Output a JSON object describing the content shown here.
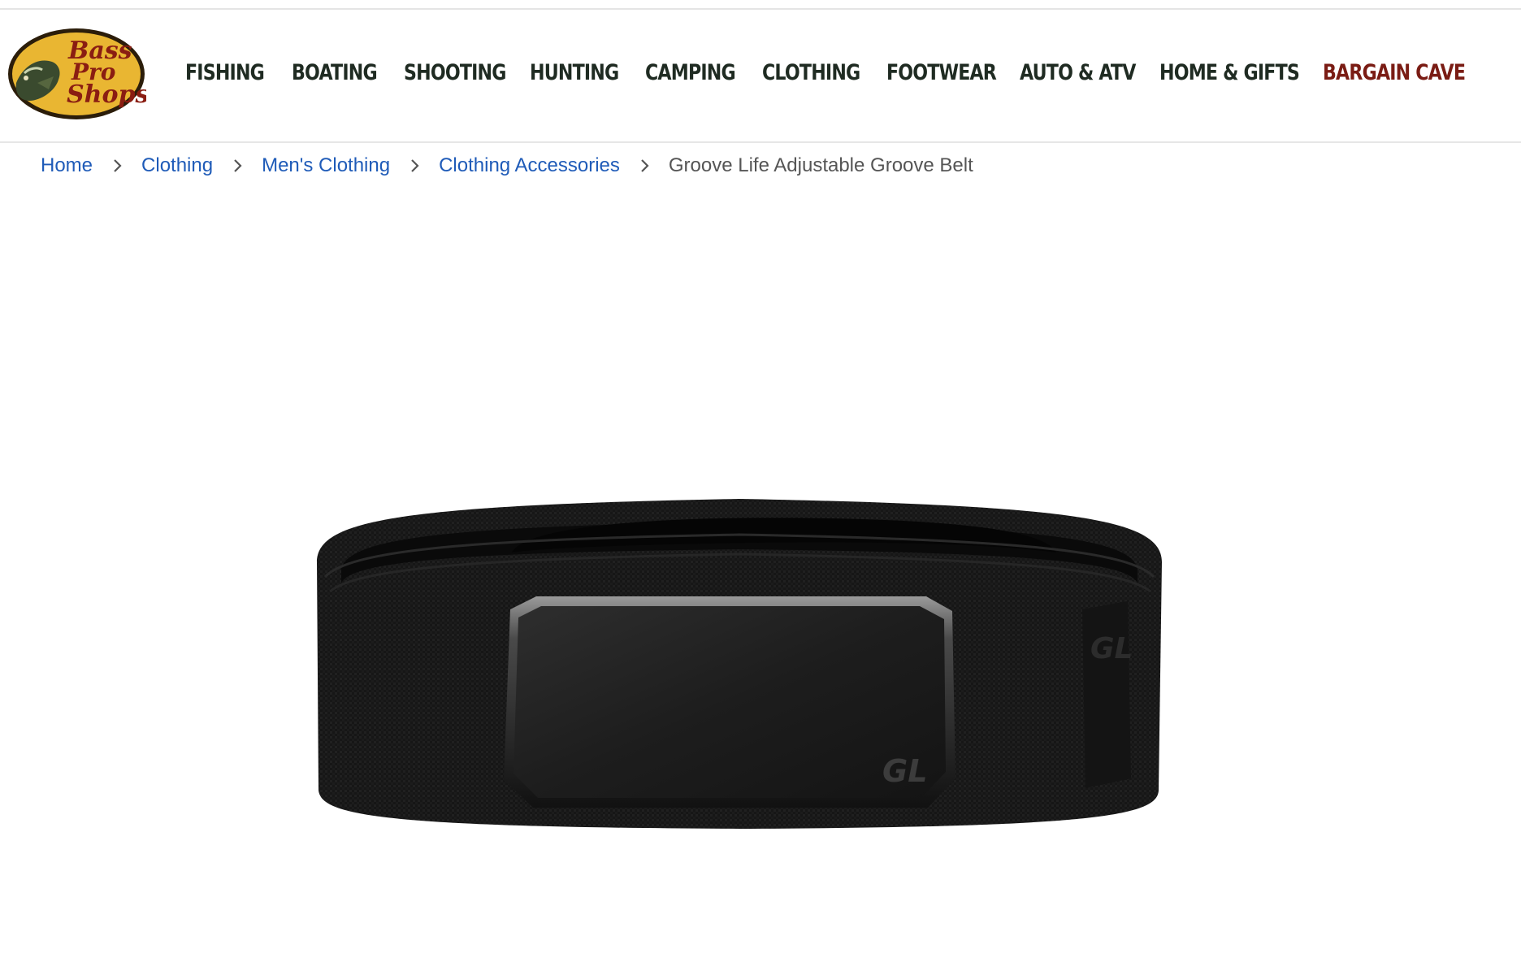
{
  "brand": {
    "logo_text_line1": "Bass",
    "logo_text_line2": "Pro",
    "logo_text_line3": "Shops",
    "colors": {
      "logo_oval": "#e9b632",
      "logo_text": "#8a1d12",
      "logo_border": "#2b1d0a"
    }
  },
  "nav": {
    "items": [
      {
        "label": "FISHING"
      },
      {
        "label": "BOATING"
      },
      {
        "label": "SHOOTING"
      },
      {
        "label": "HUNTING"
      },
      {
        "label": "CAMPING"
      },
      {
        "label": "CLOTHING"
      },
      {
        "label": "FOOTWEAR"
      },
      {
        "label": "AUTO & ATV"
      },
      {
        "label": "HOME & GIFTS"
      },
      {
        "label": "BARGAIN CAVE"
      }
    ],
    "colors": {
      "text": "#1f2b22",
      "sale": "#7a1c14"
    }
  },
  "breadcrumb": {
    "items": [
      "Home",
      "Clothing",
      "Men's Clothing",
      "Clothing Accessories"
    ],
    "current": "Groove Life Adjustable Groove Belt",
    "colors": {
      "link": "#1f5bb8",
      "current": "#555555"
    }
  },
  "product": {
    "image_icon": "belt-product-image",
    "buckle_mark": "GL"
  }
}
